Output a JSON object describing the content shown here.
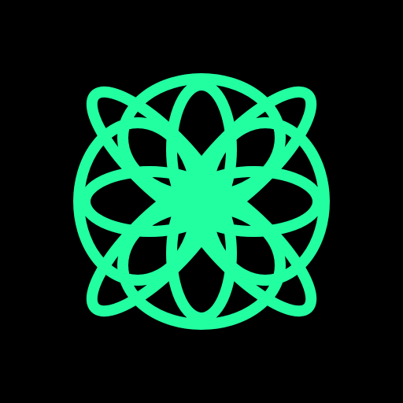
{
  "background_color": "#000000",
  "logo": {
    "icon": "interlaced-floral-knot-icon",
    "stroke_color": "#22FFA0"
  }
}
